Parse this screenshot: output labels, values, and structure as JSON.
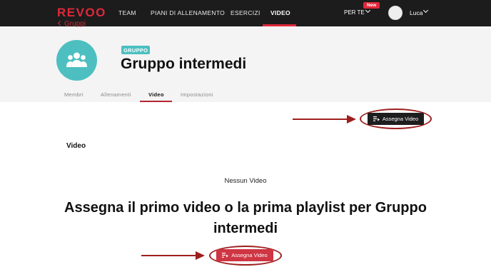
{
  "nav": {
    "logo": "REVOO",
    "links": [
      "TEAM",
      "PIANI DI ALLENAMENTO",
      "ESERCIZI",
      "VIDEO"
    ],
    "per_te": "PER TE",
    "new_badge": "New",
    "user": "Luca"
  },
  "header": {
    "back_label": "Gruppi",
    "badge": "GRUPPO",
    "title": "Gruppo intermedi",
    "tabs": [
      "Membri",
      "Allenamenti",
      "Video",
      "Impostazioni"
    ]
  },
  "content": {
    "assign_button": "Assegna Video",
    "section_title": "Video",
    "empty_title": "Nessun Video",
    "empty_heading": "Assegna il primo video o la prima playlist per Gruppo intermedi",
    "cta_button": "Assegna Video"
  },
  "colors": {
    "brand_red": "#e0283a",
    "nav_bg": "#1c1c1c",
    "group_teal": "#4dbfc0",
    "annotation_red": "#9e1e1e"
  },
  "icons": [
    "people-group-icon",
    "playlist-add-icon",
    "chevron-down-icon",
    "chevron-left-icon"
  ]
}
